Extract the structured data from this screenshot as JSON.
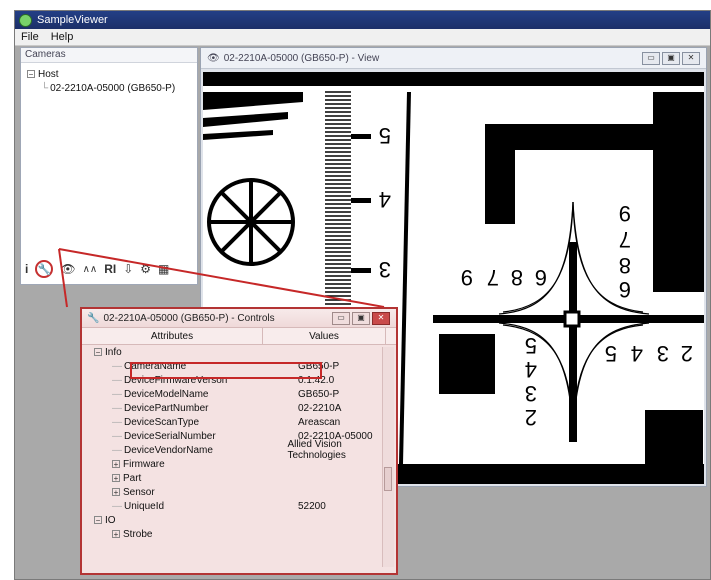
{
  "window": {
    "title": "SampleViewer"
  },
  "menu": {
    "items": [
      "File",
      "Help"
    ]
  },
  "cameras_panel": {
    "title": "Cameras",
    "tree": [
      {
        "label": "Host"
      },
      {
        "label": "02-2210A-05000 (GB650-P)"
      }
    ],
    "toolbar_icons": [
      "info-icon",
      "wrench-icon",
      "eye-icon",
      "histogram-icon",
      "roi-icon",
      "save-icon",
      "gear-icon",
      "camera-icon"
    ]
  },
  "view_window": {
    "title": "02-2210A-05000 (GB650-P) - View",
    "chart_labels": [
      "5",
      "4",
      "3",
      "9",
      "7",
      "8",
      "6",
      "9",
      "7",
      "8",
      "6",
      "5",
      "4",
      "3",
      "2",
      "5",
      "4",
      "3",
      "2"
    ]
  },
  "controls_window": {
    "title": "02-2210A-05000 (GB650-P) - Controls",
    "headers": [
      "Attributes",
      "Values"
    ],
    "rows": [
      {
        "attr": "Info",
        "value": "",
        "indent": 1,
        "expander": "minus"
      },
      {
        "attr": "CameraName",
        "value": "GB650-P",
        "indent": 2,
        "expander": ""
      },
      {
        "attr": "DeviceFirmwareVerson",
        "value": "0.1.42.0",
        "indent": 2,
        "expander": ""
      },
      {
        "attr": "DeviceModelName",
        "value": "GB650-P",
        "indent": 2,
        "expander": ""
      },
      {
        "attr": "DevicePartNumber",
        "value": "02-2210A",
        "indent": 2,
        "expander": ""
      },
      {
        "attr": "DeviceScanType",
        "value": "Areascan",
        "indent": 2,
        "expander": ""
      },
      {
        "attr": "DeviceSerialNumber",
        "value": "02-2210A-05000",
        "indent": 2,
        "expander": ""
      },
      {
        "attr": "DeviceVendorName",
        "value": "Allied Vision Technologies",
        "indent": 2,
        "expander": ""
      },
      {
        "attr": "Firmware",
        "value": "",
        "indent": 2,
        "expander": "plus"
      },
      {
        "attr": "Part",
        "value": "",
        "indent": 2,
        "expander": "plus"
      },
      {
        "attr": "Sensor",
        "value": "",
        "indent": 2,
        "expander": "plus"
      },
      {
        "attr": "UniqueId",
        "value": "52200",
        "indent": 2,
        "expander": ""
      },
      {
        "attr": "IO",
        "value": "",
        "indent": 1,
        "expander": "minus"
      },
      {
        "attr": "Strobe",
        "value": "",
        "indent": 2,
        "expander": "plus"
      }
    ]
  },
  "colors": {
    "accent_red": "#c62828",
    "titlebar": "#233f86"
  }
}
